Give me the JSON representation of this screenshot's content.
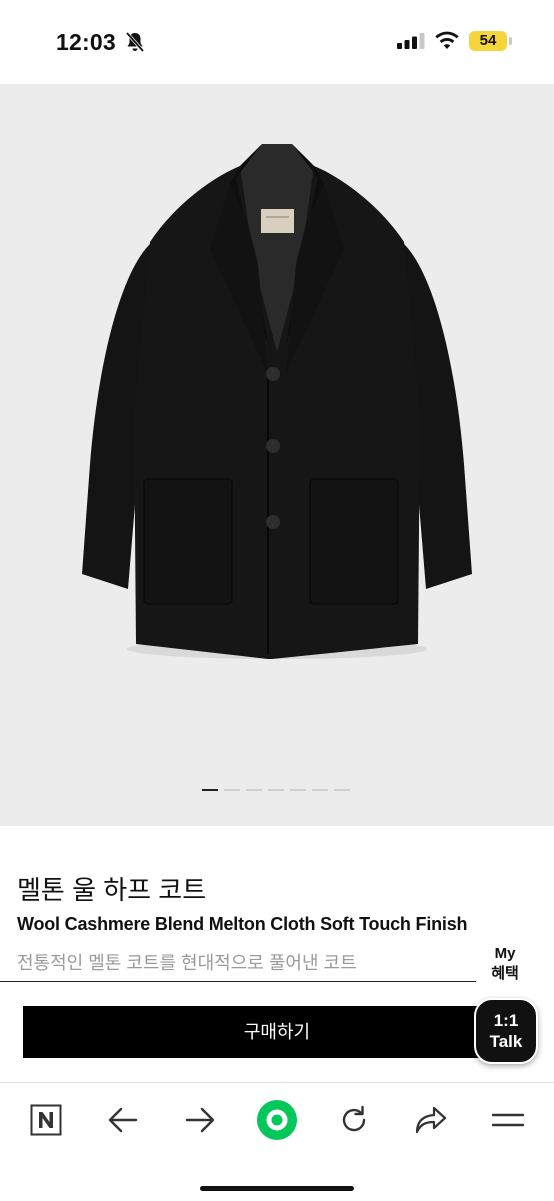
{
  "status_bar": {
    "time": "12:03",
    "battery": "54",
    "battery_color": "#f5d53c"
  },
  "gallery": {
    "slide_count": 7,
    "active_index": 0
  },
  "product": {
    "title_ko": "멜톤 울 하프 코트",
    "title_en": "Wool Cashmere Blend Melton Cloth Soft Touch Finish",
    "description": "전통적인 멜톤 코트를 현대적으로 풀어낸 코트"
  },
  "benefit": {
    "line1": "My",
    "line2": "혜택"
  },
  "buy": {
    "label": "구매하기"
  },
  "talk": {
    "line1": "1:1",
    "line2": "Talk"
  },
  "toolbar": {
    "items": [
      "naver-icon",
      "back-arrow-icon",
      "forward-arrow-icon",
      "green-home-icon",
      "refresh-icon",
      "share-icon",
      "menu-icon"
    ],
    "accent": "#03c75a"
  }
}
